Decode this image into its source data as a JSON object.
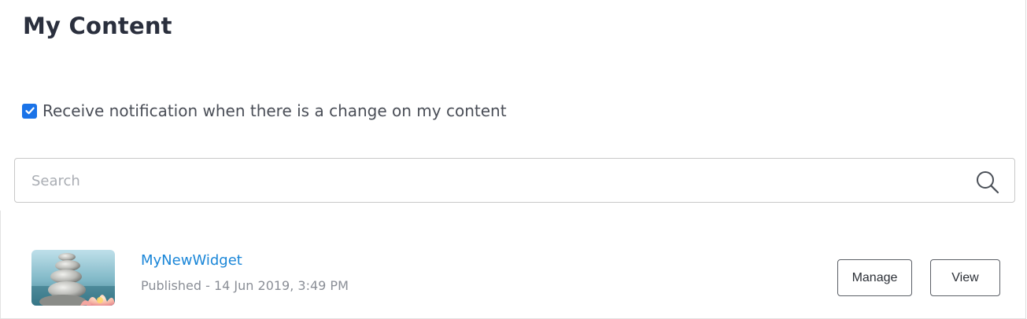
{
  "page": {
    "title": "My Content"
  },
  "notifications": {
    "checked": true,
    "label": "Receive notification when there is a change on my content"
  },
  "search": {
    "placeholder": "Search",
    "value": "",
    "icon": "search-icon"
  },
  "content_list": [
    {
      "title": "MyNewWidget",
      "status": "Published - 14 Jun 2019, 3:49 PM",
      "thumbnail": "stacked-stones-lotus-image",
      "actions": {
        "manage_label": "Manage",
        "view_label": "View"
      }
    }
  ],
  "colors": {
    "accent": "#1a73e8",
    "link": "#1a86d8",
    "title_text": "#2a2f3d",
    "muted_text": "#8a8e96"
  }
}
